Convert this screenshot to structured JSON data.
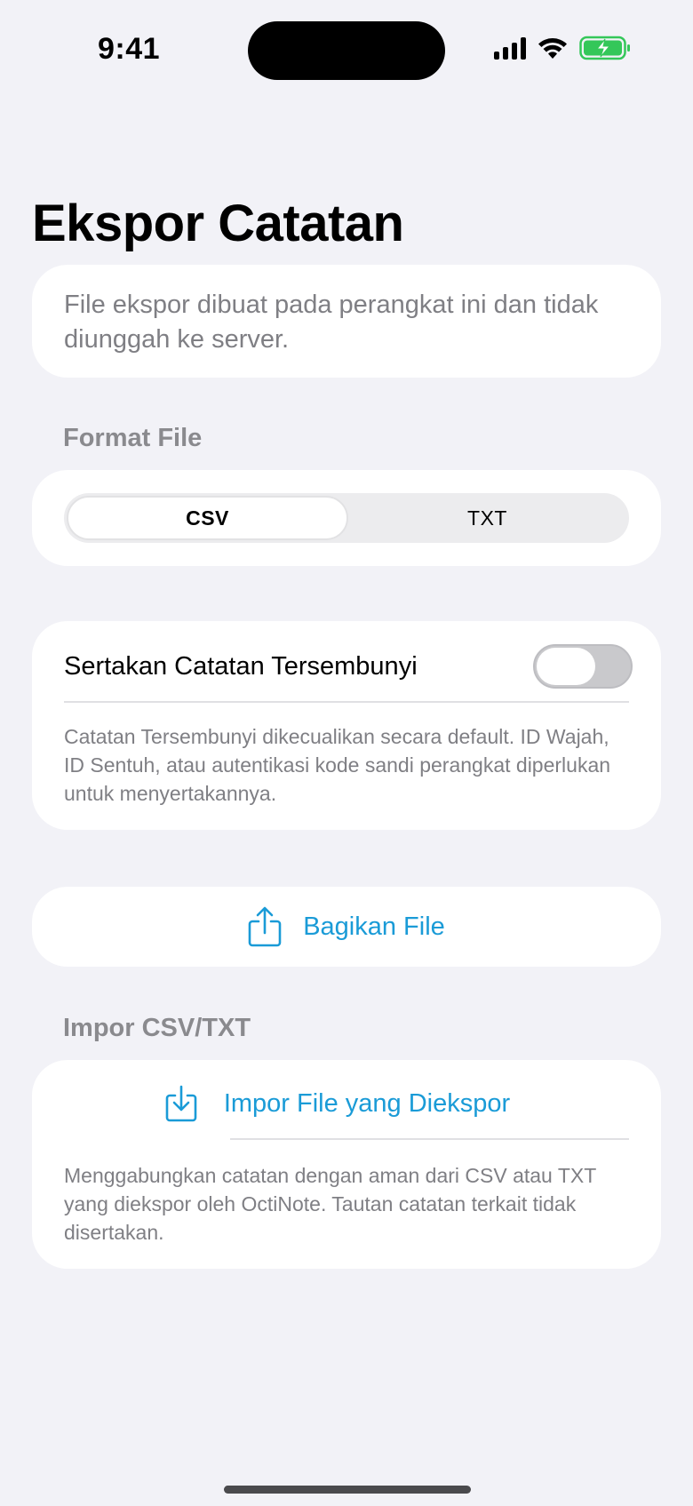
{
  "status_bar": {
    "time": "9:41"
  },
  "page": {
    "title": "Ekspor Catatan"
  },
  "info_card": {
    "text": "File ekspor dibuat pada perangkat ini dan tidak diunggah ke server."
  },
  "format_section": {
    "label": "Format File",
    "options": [
      "CSV",
      "TXT"
    ],
    "selected": "CSV"
  },
  "hidden_notes": {
    "label": "Sertakan Catatan Tersembunyi",
    "enabled": false,
    "note": "Catatan Tersembunyi dikecualikan secara default. ID Wajah, ID Sentuh, atau autentikasi kode sandi perangkat diperlukan untuk menyertakannya."
  },
  "share": {
    "label": "Bagikan File",
    "icon": "share-icon"
  },
  "import_section": {
    "label": "Impor CSV/TXT",
    "button_label": "Impor File yang Diekspor",
    "icon": "import-icon",
    "note": "Menggabungkan catatan dengan aman dari CSV atau TXT yang diekspor oleh OctiNote. Tautan catatan terkait tidak disertakan."
  },
  "colors": {
    "accent": "#1a9bd7",
    "background": "#f2f2f7",
    "battery": "#34c759"
  }
}
